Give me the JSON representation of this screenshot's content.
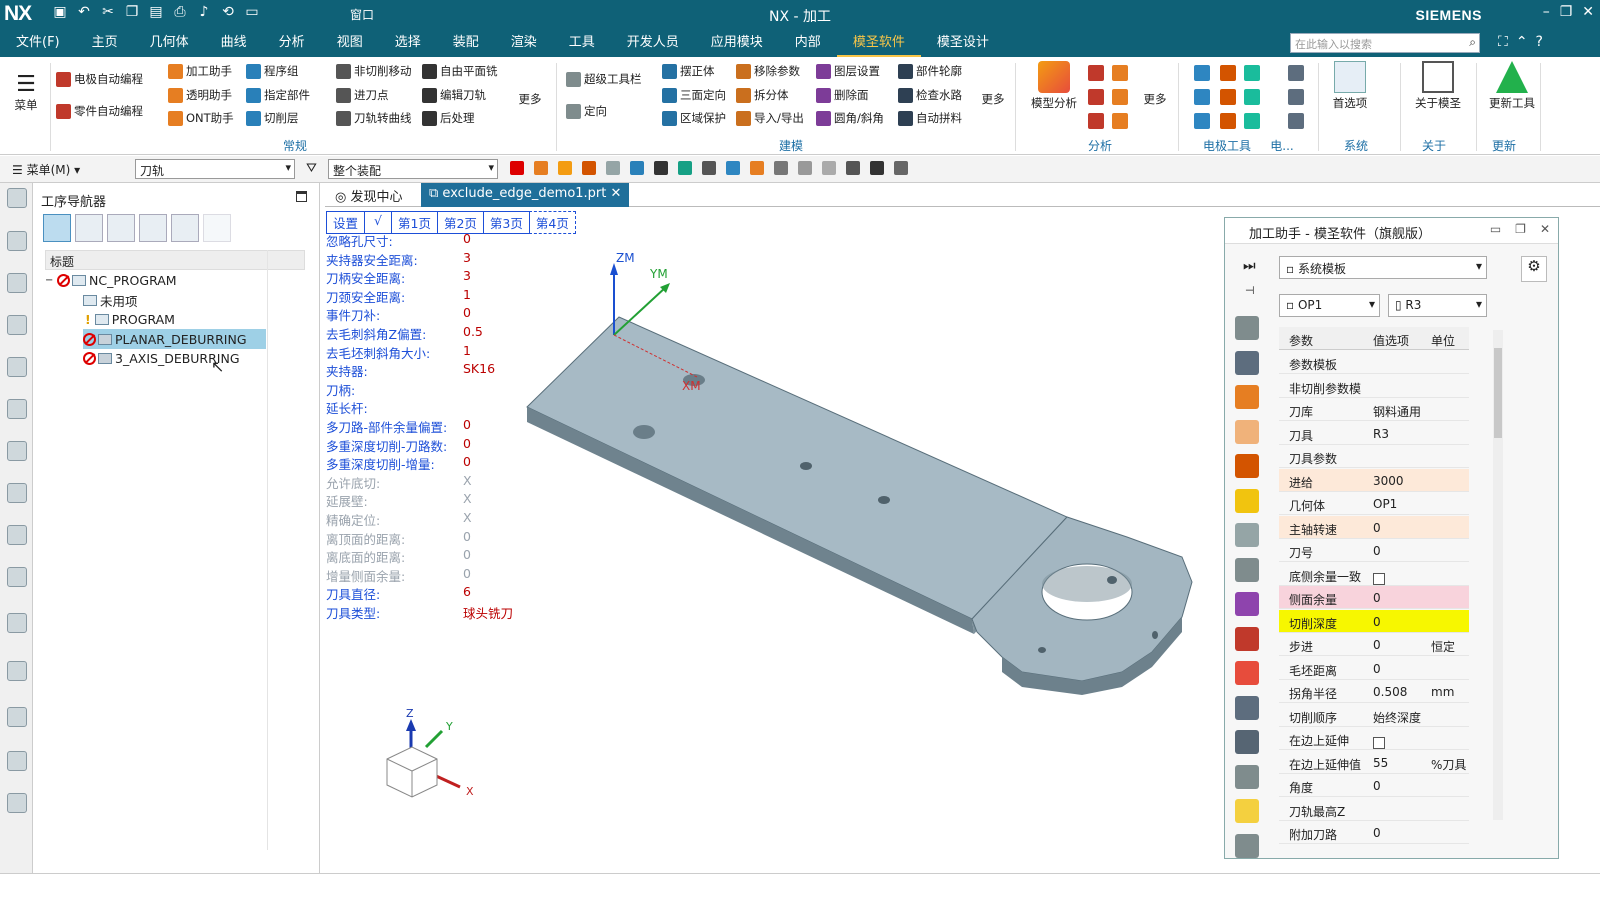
{
  "app": {
    "logo": "NX",
    "title": "NX - 加工",
    "brand": "SIEMENS",
    "window_menu": "窗口"
  },
  "menubar": {
    "items": [
      "文件(F)",
      "主页",
      "几何体",
      "曲线",
      "分析",
      "视图",
      "选择",
      "装配",
      "渲染",
      "工具",
      "开发人员",
      "应用模块",
      "内部",
      "模圣软件",
      "模圣设计"
    ],
    "active": "模圣软件",
    "search_placeholder": "在此输入以搜索"
  },
  "ribbon": {
    "menu_label": "菜单",
    "col1": [
      "电极自动编程",
      "零件自动编程"
    ],
    "col2": [
      "加工助手",
      "透明助手",
      "ONT助手"
    ],
    "col3": [
      "程序组",
      "指定部件",
      "切削层"
    ],
    "col4": [
      "非切削移动",
      "进刀点",
      "刀轨转曲线"
    ],
    "col5": [
      "自由平面铣",
      "编辑刀轨",
      "后处理"
    ],
    "more": "更多",
    "col6": [
      "超级工具栏",
      "定向"
    ],
    "col7": [
      "摆正体",
      "三面定向",
      "区域保护"
    ],
    "col8": [
      "移除参数",
      "拆分体",
      "导入/导出"
    ],
    "col9": [
      "图层设置",
      "删除面",
      "圆角/斜角"
    ],
    "col10": [
      "部件轮廓",
      "检查水路",
      "自动拼料"
    ],
    "big": [
      "模型分析",
      "首选项",
      "关于模圣",
      "更新工具"
    ],
    "groups": [
      "常规",
      "建模",
      "分析",
      "电极工具",
      "电...",
      "系统",
      "关于",
      "更新"
    ]
  },
  "toolbar2": {
    "menu": "菜单(M)",
    "filter1": "刀轨",
    "filter2": "整个装配"
  },
  "navigator": {
    "title": "工序导航器",
    "column": "标题",
    "rows": [
      "NC_PROGRAM",
      "未用项",
      "PROGRAM",
      "PLANAR_DEBURRING",
      "3_AXIS_DEBURRING"
    ]
  },
  "tabs": [
    "发现中心",
    "exclude_edge_demo1.prt"
  ],
  "pages": [
    "设置",
    "√",
    "第1页",
    "第2页",
    "第3页",
    "第4页"
  ],
  "params": [
    {
      "label": "忽略孔尺寸:",
      "value": "0",
      "dis": false
    },
    {
      "label": "夹持器安全距离:",
      "value": "3",
      "dis": false
    },
    {
      "label": "刀柄安全距离:",
      "value": "3",
      "dis": false
    },
    {
      "label": "刀颈安全距离:",
      "value": "1",
      "dis": false
    },
    {
      "label": "事件刀补:",
      "value": "0",
      "dis": false
    },
    {
      "label": "去毛刺斜角Z偏置:",
      "value": "0.5",
      "dis": false
    },
    {
      "label": "去毛坯刺斜角大小:",
      "value": "1",
      "dis": false
    },
    {
      "label": "夹持器:",
      "value": "SK16",
      "dis": false
    },
    {
      "label": "刀柄:",
      "value": "",
      "dis": false
    },
    {
      "label": "延长杆:",
      "value": "",
      "dis": false
    },
    {
      "label": "多刀路-部件余量偏置:",
      "value": "0",
      "dis": false
    },
    {
      "label": "多重深度切削-刀路数:",
      "value": "0",
      "dis": false
    },
    {
      "label": "多重深度切削-增量:",
      "value": "0",
      "dis": false
    },
    {
      "label": "允许底切:",
      "value": "X",
      "dis": true
    },
    {
      "label": "延展壁:",
      "value": "X",
      "dis": true
    },
    {
      "label": "精确定位:",
      "value": "X",
      "dis": true
    },
    {
      "label": "离顶面的距离:",
      "value": "0",
      "dis": true
    },
    {
      "label": "离底面的距离:",
      "value": "0",
      "dis": true
    },
    {
      "label": "增量侧面余量:",
      "value": "0",
      "dis": true
    },
    {
      "label": "刀具直径:",
      "value": "6",
      "dis": false
    },
    {
      "label": "刀具类型:",
      "value": "球头铣刀",
      "dis": false
    }
  ],
  "axes": {
    "zm": "ZM",
    "ym": "YM",
    "xm": "XM",
    "z": "Z",
    "y": "Y",
    "x": "X"
  },
  "helper": {
    "title": "加工助手 - 模圣软件（旗舰版）",
    "template": "系统模板",
    "op": "OP1",
    "tool": "R3",
    "headers": [
      "参数",
      "值选项",
      "单位"
    ],
    "rows": [
      {
        "p": "参数模板",
        "v": "",
        "u": "",
        "bg": ""
      },
      {
        "p": "非切削参数模",
        "v": "",
        "u": "",
        "bg": ""
      },
      {
        "p": "刀库",
        "v": "钢料通用",
        "u": "",
        "bg": ""
      },
      {
        "p": "刀具",
        "v": "R3",
        "u": "",
        "bg": ""
      },
      {
        "p": "刀具参数",
        "v": "",
        "u": "",
        "bg": ""
      },
      {
        "p": "进给",
        "v": "3000",
        "u": "",
        "bg": "#fde9d9"
      },
      {
        "p": "几何体",
        "v": "OP1",
        "u": "",
        "bg": ""
      },
      {
        "p": "主轴转速",
        "v": "0",
        "u": "",
        "bg": "#fde9d9"
      },
      {
        "p": "刀号",
        "v": "0",
        "u": "",
        "bg": ""
      },
      {
        "p": "底侧余量一致",
        "v": "",
        "u": "",
        "bg": "",
        "chk": true
      },
      {
        "p": "侧面余量",
        "v": "0",
        "u": "",
        "bg": "#f8d3dc"
      },
      {
        "p": "切削深度",
        "v": "0",
        "u": "",
        "bg": "#f7f700"
      },
      {
        "p": "步进",
        "v": "0",
        "u": "恒定",
        "bg": ""
      },
      {
        "p": "毛坯距离",
        "v": "0",
        "u": "",
        "bg": ""
      },
      {
        "p": "拐角半径",
        "v": "0.508",
        "u": "mm",
        "bg": ""
      },
      {
        "p": "切削顺序",
        "v": "始终深度",
        "u": "",
        "bg": ""
      },
      {
        "p": "在边上延伸",
        "v": "",
        "u": "",
        "bg": "",
        "chk": true
      },
      {
        "p": "在边上延伸值",
        "v": "55",
        "u": "%刀具",
        "bg": ""
      },
      {
        "p": "角度",
        "v": "0",
        "u": "",
        "bg": ""
      },
      {
        "p": "刀轨最高Z",
        "v": "",
        "u": "",
        "bg": ""
      },
      {
        "p": "附加刀路",
        "v": "0",
        "u": "",
        "bg": ""
      }
    ]
  },
  "colors": {
    "titlebar": "#0f6177",
    "accent": "#f7c548",
    "part": "#9fb3bf",
    "label_blue": "#1d4fd8",
    "value_red": "#b00000"
  }
}
